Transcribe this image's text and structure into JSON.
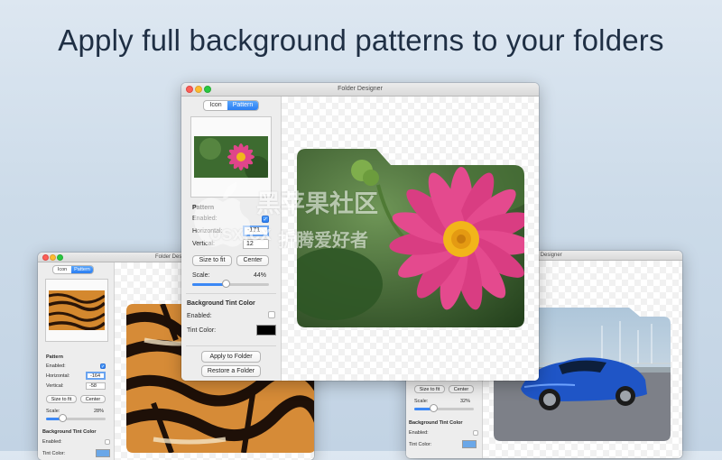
{
  "headline": "Apply full background patterns to your folders",
  "window_title": "Folder Designer",
  "colors": {
    "accent": "#2a7ef3",
    "swatch_black": "#000000",
    "swatch_blue": "#6aa7e8"
  },
  "watermark": {
    "line1": "黑苹果社区",
    "line2": "osx.cx",
    "line3": "折腾爱好者"
  },
  "main": {
    "tabs": [
      {
        "label": "Icon",
        "active": false
      },
      {
        "label": "Pattern",
        "active": true
      }
    ],
    "pattern_section": "Pattern",
    "enabled_label": "Enabled:",
    "horizontal_label": "Horizontal:",
    "horizontal_value": "-171",
    "vertical_label": "Vertical:",
    "vertical_value": "12",
    "size_to_fit": "Size to fit",
    "center": "Center",
    "scale_label": "Scale:",
    "scale_value": "44%",
    "scale_fraction": 0.44,
    "tint_section": "Background Tint Color",
    "tint_enabled_label": "Enabled:",
    "tint_color_label": "Tint Color:",
    "apply_button": "Apply to Folder",
    "restore_button": "Restore a Folder"
  },
  "left": {
    "tabs": [
      {
        "label": "Icon",
        "active": false
      },
      {
        "label": "Pattern",
        "active": true
      }
    ],
    "pattern_section": "Pattern",
    "enabled_label": "Enabled:",
    "horizontal_label": "Horizontal:",
    "horizontal_value": "-164",
    "vertical_label": "Vertical:",
    "vertical_value": "-58",
    "size_to_fit": "Size to fit",
    "center": "Center",
    "scale_label": "Scale:",
    "scale_value": "28%",
    "scale_fraction": 0.28,
    "tint_section": "Background Tint Color",
    "tint_enabled_label": "Enabled:",
    "tint_color_label": "Tint Color:"
  },
  "right": {
    "title": "Folder Designer",
    "size_to_fit": "Size to fit",
    "center": "Center",
    "scale_label": "Scale:",
    "scale_value": "32%",
    "scale_fraction": 0.32,
    "tint_section": "Background Tint Color",
    "tint_enabled_label": "Enabled:",
    "tint_color_label": "Tint Color:"
  }
}
